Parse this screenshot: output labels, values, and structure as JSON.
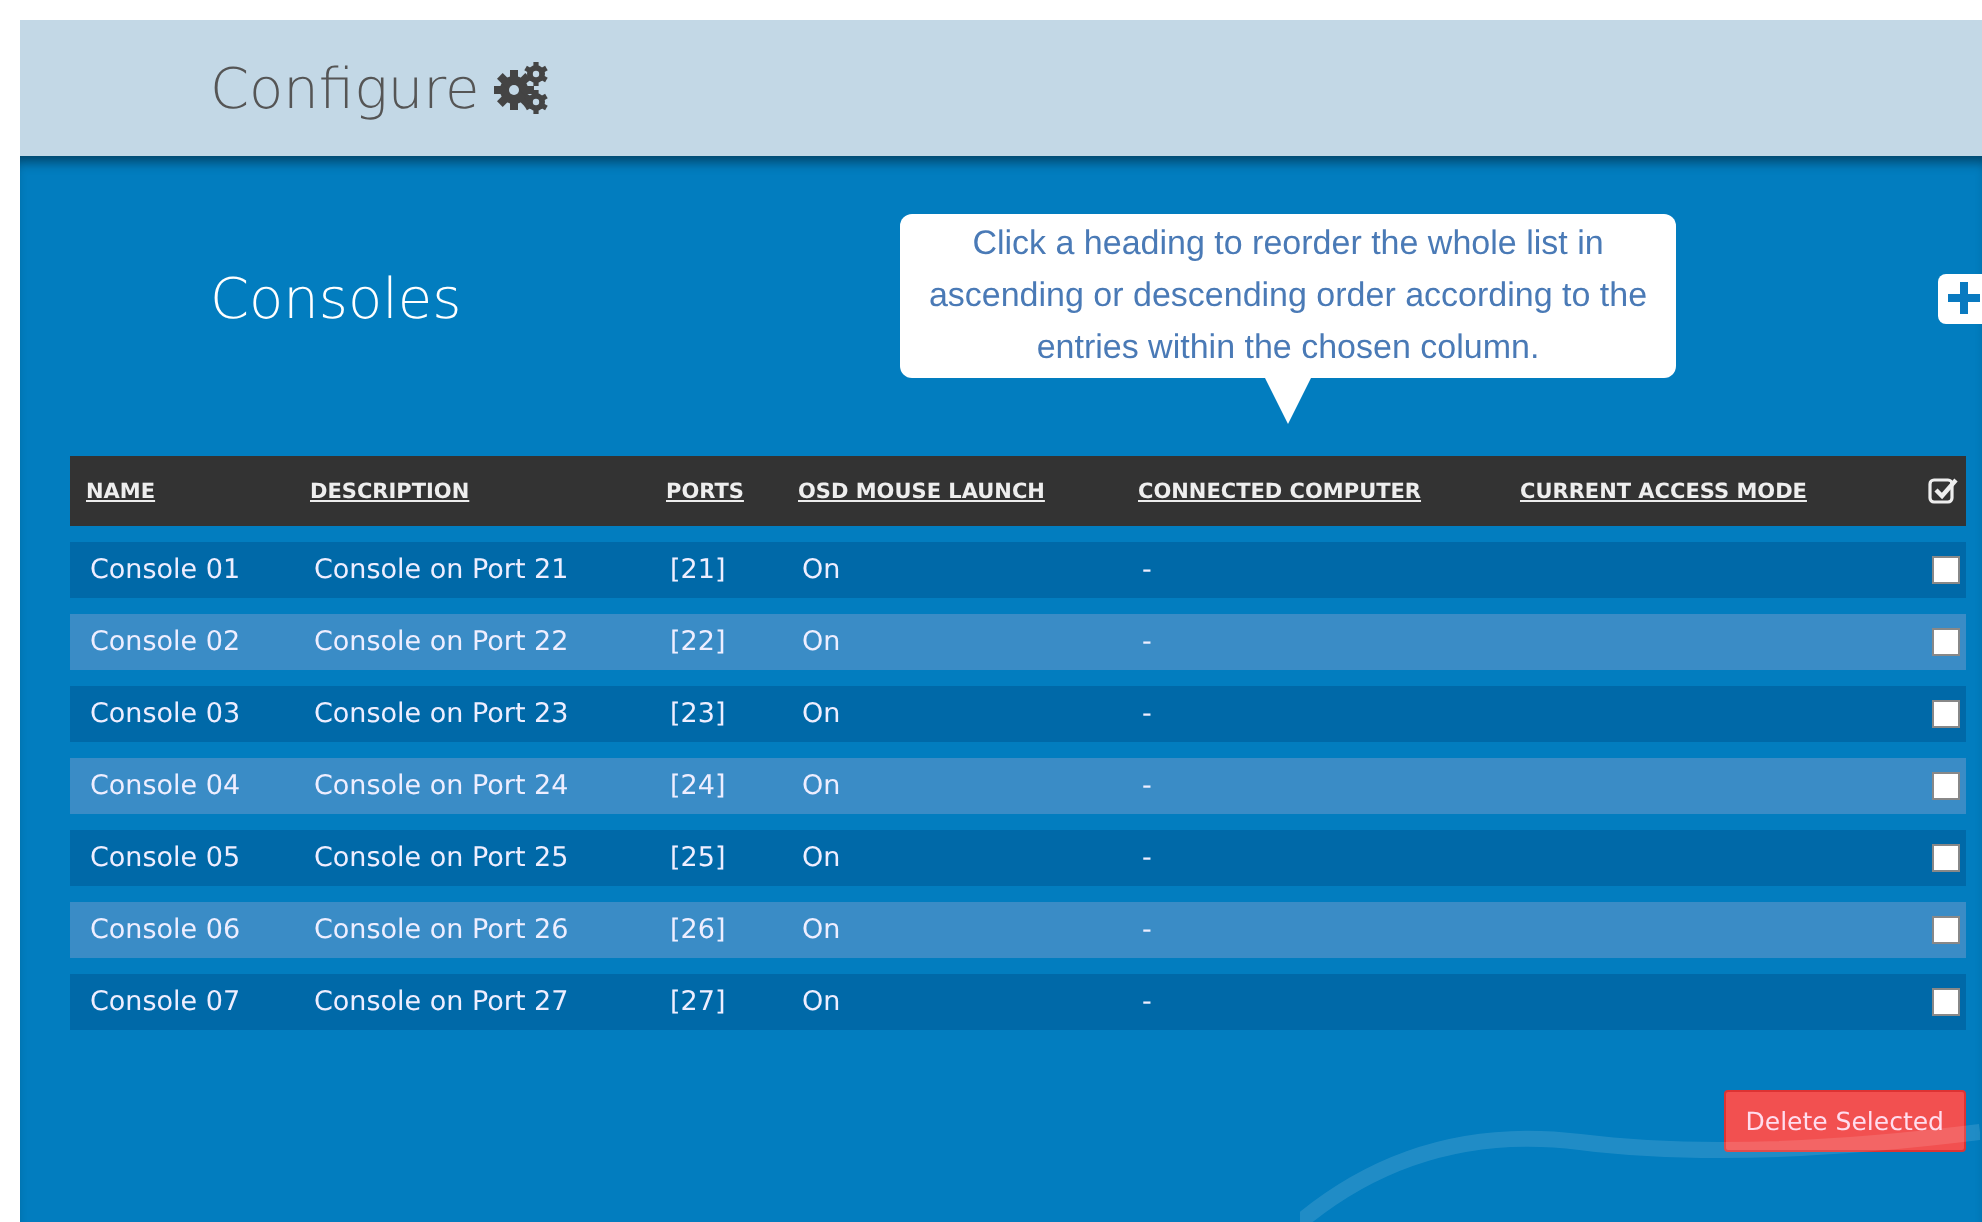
{
  "header": {
    "title": "Configure"
  },
  "section": {
    "title": "Consoles"
  },
  "tooltip": {
    "text": "Click a heading to reorder the whole list in ascending or descending order according to the entries within the chosen column."
  },
  "table": {
    "columns": [
      "NAME",
      "DESCRIPTION",
      "PORTS",
      "OSD MOUSE LAUNCH",
      "CONNECTED COMPUTER",
      "CURRENT ACCESS MODE"
    ],
    "rows": [
      {
        "name": "Console 01",
        "description": "Console on Port 21",
        "ports": "[21]",
        "osd_mouse_launch": "On",
        "connected_computer": "-",
        "checked": false
      },
      {
        "name": "Console 02",
        "description": "Console on Port 22",
        "ports": "[22]",
        "osd_mouse_launch": "On",
        "connected_computer": "-",
        "checked": false
      },
      {
        "name": "Console 03",
        "description": "Console on Port 23",
        "ports": "[23]",
        "osd_mouse_launch": "On",
        "connected_computer": "-",
        "checked": false
      },
      {
        "name": "Console 04",
        "description": "Console on Port 24",
        "ports": "[24]",
        "osd_mouse_launch": "On",
        "connected_computer": "-",
        "checked": false
      },
      {
        "name": "Console 05",
        "description": "Console on Port 25",
        "ports": "[25]",
        "osd_mouse_launch": "On",
        "connected_computer": "-",
        "checked": false
      },
      {
        "name": "Console 06",
        "description": "Console on Port 26",
        "ports": "[26]",
        "osd_mouse_launch": "On",
        "connected_computer": "-",
        "checked": false
      },
      {
        "name": "Console 07",
        "description": "Console on Port 27",
        "ports": "[27]",
        "osd_mouse_launch": "On",
        "connected_computer": "-",
        "checked": false
      }
    ]
  },
  "delete_button": "Delete Selected"
}
